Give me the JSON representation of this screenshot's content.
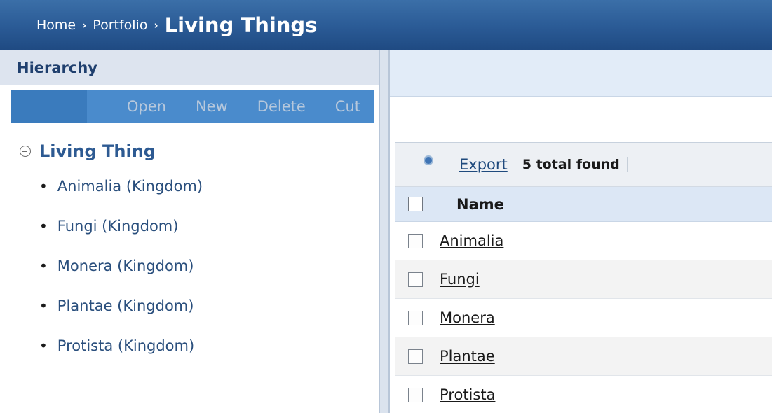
{
  "breadcrumb": {
    "items": [
      "Home",
      "Portfolio"
    ],
    "separator": "›",
    "current": "Living Things"
  },
  "hierarchy": {
    "title": "Hierarchy",
    "toolbar": [
      "Open",
      "New",
      "Delete",
      "Cut"
    ],
    "root": "Living Thing",
    "children": [
      "Animalia (Kingdom)",
      "Fungi (Kingdom)",
      "Monera (Kingdom)",
      "Plantae (Kingdom)",
      "Protista (Kingdom)"
    ]
  },
  "grid": {
    "export_label": "Export",
    "total_found": "5 total found",
    "column_name": "Name",
    "rows": [
      "Animalia",
      "Fungi",
      "Monera",
      "Plantae",
      "Protista"
    ]
  },
  "colors": {
    "topbar": "#2a5a95",
    "panel_header": "#dde4ef",
    "toolbar": "#4a8bcc",
    "link": "#2d5a92"
  },
  "icons": {
    "collapse": "circle-minus-icon",
    "refresh": "refresh-icon",
    "checkbox": "checkbox-icon"
  }
}
